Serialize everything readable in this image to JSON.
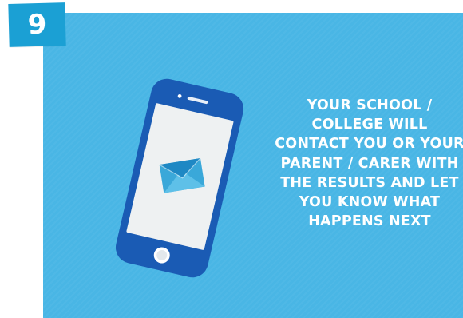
{
  "step": {
    "number": "9"
  },
  "message": {
    "lines": [
      "YOUR SCHOOL /",
      "COLLEGE WILL",
      "CONTACT YOU OR YOUR",
      "PARENT / CARER WITH",
      "THE RESULTS AND LET",
      "YOU KNOW WHAT",
      "HAPPENS NEXT"
    ]
  },
  "colors": {
    "card_background": "#49b6e5",
    "badge_background": "#1ba0d4",
    "phone_body": "#1a5bb4",
    "phone_screen": "#eef1f2",
    "envelope": "#3aa8d9",
    "text": "#ffffff"
  },
  "icons": {
    "phone": "smartphone-icon",
    "envelope": "envelope-icon"
  }
}
